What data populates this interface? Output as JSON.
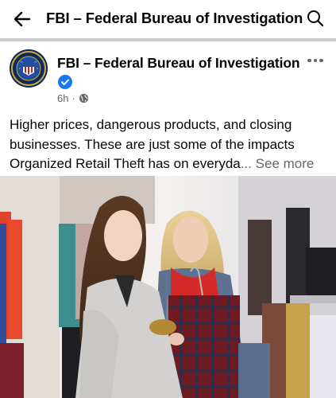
{
  "topbar": {
    "title": "FBI – Federal Bureau of Investigation",
    "back_icon": "arrow-left-icon",
    "search_icon": "search-icon"
  },
  "post": {
    "author": "FBI – Federal Bureau of Investigation",
    "time": "6h",
    "separator": "·",
    "audience_icon": "globe-icon",
    "verified_icon": "verified-badge-icon",
    "text_lines": [
      "Higher prices, dangerous products, and closing",
      "businesses. These are just some of the impacts",
      "Organized Retail Theft has on everyda"
    ],
    "ellipsis": "...",
    "see_more": "See more"
  },
  "colors": {
    "divider": "#c9ccd1",
    "secondary_text": "#65676b",
    "verified_blue": "#1877f2"
  }
}
